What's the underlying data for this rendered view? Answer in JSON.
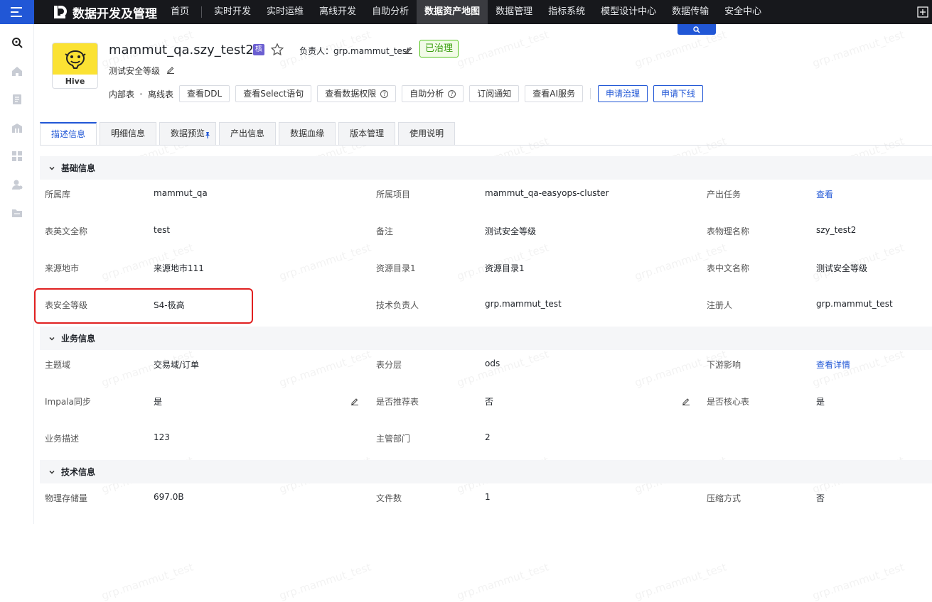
{
  "nav": {
    "logo_text": "数据开发及管理",
    "items": [
      "首页",
      "实时开发",
      "实时运维",
      "离线开发",
      "自助分析",
      "数据资产地图",
      "数据管理",
      "指标系统",
      "模型设计中心",
      "数据传输",
      "安全中心"
    ],
    "active_index": 5
  },
  "header": {
    "icon_label": "Hive",
    "title": "mammut_qa.szy_test2",
    "core_badge": "核",
    "owner_label": "负责人：",
    "owner_value": "grp.mammut_test",
    "governed_badge": "已治理",
    "subtitle": "测试安全等级",
    "table_type": "内部表",
    "table_kind": "离线表",
    "buttons": [
      "查看DDL",
      "查看Select语句",
      "查看数据权限",
      "自助分析",
      "订阅通知",
      "查看AI服务"
    ],
    "primary_buttons": [
      "申请治理",
      "申请下线"
    ]
  },
  "tabs": [
    "描述信息",
    "明细信息",
    "数据预览",
    "产出信息",
    "数据血缘",
    "版本管理",
    "使用说明"
  ],
  "sections": {
    "basic": {
      "title": "基础信息",
      "rows": [
        [
          {
            "label": "所属库",
            "value": "mammut_qa"
          },
          {
            "label": "所属项目",
            "value": "mammut_qa-easyops-cluster"
          },
          {
            "label": "产出任务",
            "value": "查看"
          }
        ],
        [
          {
            "label": "表英文全称",
            "value": "test"
          },
          {
            "label": "备注",
            "value": "测试安全等级"
          },
          {
            "label": "表物理名称",
            "value": "szy_test2"
          }
        ],
        [
          {
            "label": "来源地市",
            "value": "来源地市111"
          },
          {
            "label": "资源目录1",
            "value": "资源目录1"
          },
          {
            "label": "表中文名称",
            "value": "测试安全等级"
          }
        ],
        [
          {
            "label": "表安全等级",
            "value": "S4-极高"
          },
          {
            "label": "技术负责人",
            "value": "grp.mammut_test"
          },
          {
            "label": "注册人",
            "value": "grp.mammut_test"
          }
        ]
      ]
    },
    "business": {
      "title": "业务信息",
      "rows": [
        [
          {
            "label": "主题域",
            "value": "交易域/订单"
          },
          {
            "label": "表分层",
            "value": "ods"
          },
          {
            "label": "下游影响",
            "value": "查看详情"
          }
        ],
        [
          {
            "label": "Impala同步",
            "value": "是"
          },
          {
            "label": "是否推荐表",
            "value": "否"
          },
          {
            "label": "是否核心表",
            "value": "是"
          }
        ],
        [
          {
            "label": "业务描述",
            "value": "123"
          },
          {
            "label": "主管部门",
            "value": "2"
          }
        ]
      ]
    },
    "tech": {
      "title": "技术信息",
      "rows": [
        [
          {
            "label": "物理存储量",
            "value": "697.0B"
          },
          {
            "label": "文件数",
            "value": "1"
          },
          {
            "label": "压缩方式",
            "value": "否"
          }
        ]
      ]
    }
  },
  "watermark": "grp.mammut_test",
  "colors": {
    "accent": "#2157d6",
    "topbar": "#17181c",
    "highlight": "#e02020",
    "governed": "#52c41a"
  }
}
